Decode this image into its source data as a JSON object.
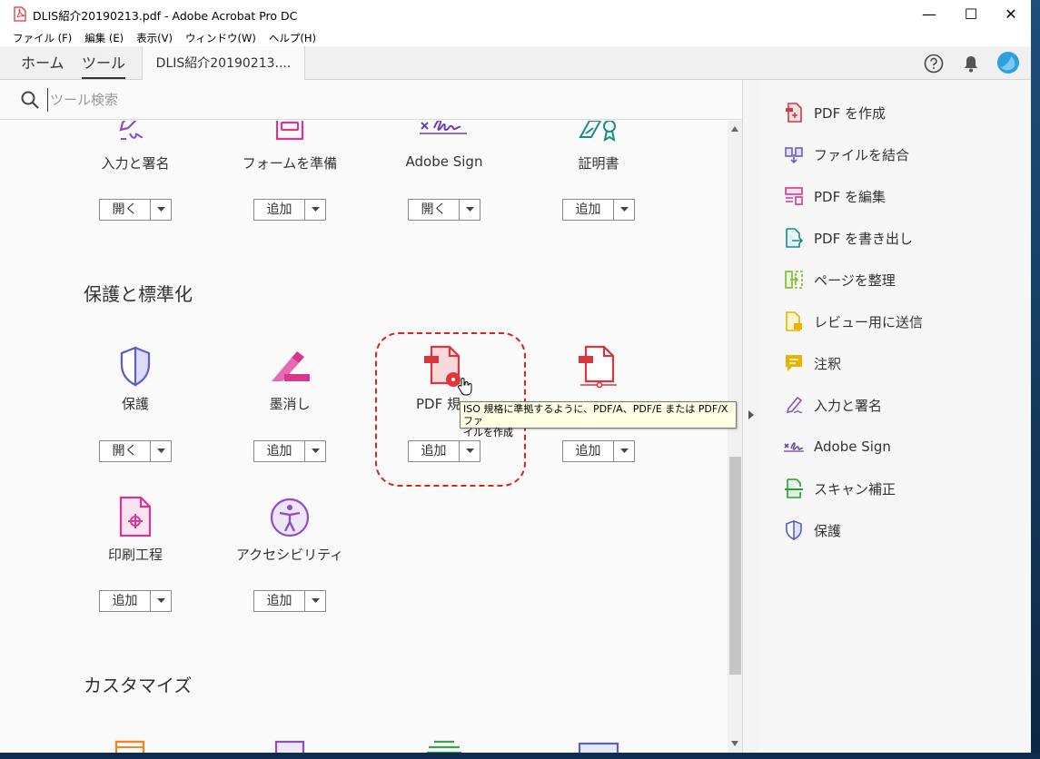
{
  "window": {
    "title": "DLIS紹介20190213.pdf - Adobe Acrobat Pro DC",
    "minimize": "—",
    "maximize": "☐",
    "close": "✕"
  },
  "menu": [
    "ファイル (F)",
    "編集 (E)",
    "表示(V)",
    "ウィンドウ(W)",
    "ヘルプ(H)"
  ],
  "tabs": {
    "home": "ホーム",
    "tools": "ツール",
    "document": "DLIS紹介20190213...."
  },
  "search": {
    "placeholder": "ツール検索"
  },
  "tools_top": [
    {
      "name": "入力と署名",
      "button": "開く",
      "icon": "fill-sign-icon"
    },
    {
      "name": "フォームを準備",
      "button": "追加",
      "icon": "prepare-form-icon"
    },
    {
      "name": "Adobe Sign",
      "button": "開く",
      "icon": "adobe-sign-icon"
    },
    {
      "name": "証明書",
      "button": "追加",
      "icon": "certificate-icon"
    }
  ],
  "section_protect": {
    "title": "保護と標準化",
    "tools": [
      {
        "name": "保護",
        "button": "開く",
        "icon": "shield-icon"
      },
      {
        "name": "墨消し",
        "button": "追加",
        "icon": "redact-icon"
      },
      {
        "name": "PDF 規",
        "button": "追加",
        "icon": "pdf-standards-icon"
      },
      {
        "name": "",
        "button": "追加",
        "icon": "pdf-compare-icon"
      },
      {
        "name": "印刷工程",
        "button": "追加",
        "icon": "print-production-icon"
      },
      {
        "name": "アクセシビリティ",
        "button": "追加",
        "icon": "accessibility-icon"
      }
    ]
  },
  "section_custom": {
    "title": "カスタマイズ"
  },
  "tooltip": {
    "line1": "ISO 規格に準拠するように、PDF/A、PDF/E または PDF/X ファ",
    "line2": "イルを作成"
  },
  "right_pane": [
    {
      "label": "PDF を作成",
      "icon": "create-pdf-icon",
      "color": "#d7373f"
    },
    {
      "label": "ファイルを結合",
      "icon": "combine-files-icon",
      "color": "#6b5ec9"
    },
    {
      "label": "PDF を編集",
      "icon": "edit-pdf-icon",
      "color": "#d83790"
    },
    {
      "label": "PDF を書き出し",
      "icon": "export-pdf-icon",
      "color": "#1b8a8a"
    },
    {
      "label": "ページを整理",
      "icon": "organize-pages-icon",
      "color": "#7cba2b"
    },
    {
      "label": "レビュー用に送信",
      "icon": "send-review-icon",
      "color": "#e8b400"
    },
    {
      "label": "注釈",
      "icon": "comment-icon",
      "color": "#e8b400"
    },
    {
      "label": "入力と署名",
      "icon": "fill-sign-icon",
      "color": "#8a4fc4"
    },
    {
      "label": "Adobe Sign",
      "icon": "adobe-sign-icon",
      "color": "#6b3fb4"
    },
    {
      "label": "スキャン補正",
      "icon": "scan-icon",
      "color": "#2d9a3e"
    },
    {
      "label": "保護",
      "icon": "shield-icon",
      "color": "#5b5fc7"
    }
  ]
}
